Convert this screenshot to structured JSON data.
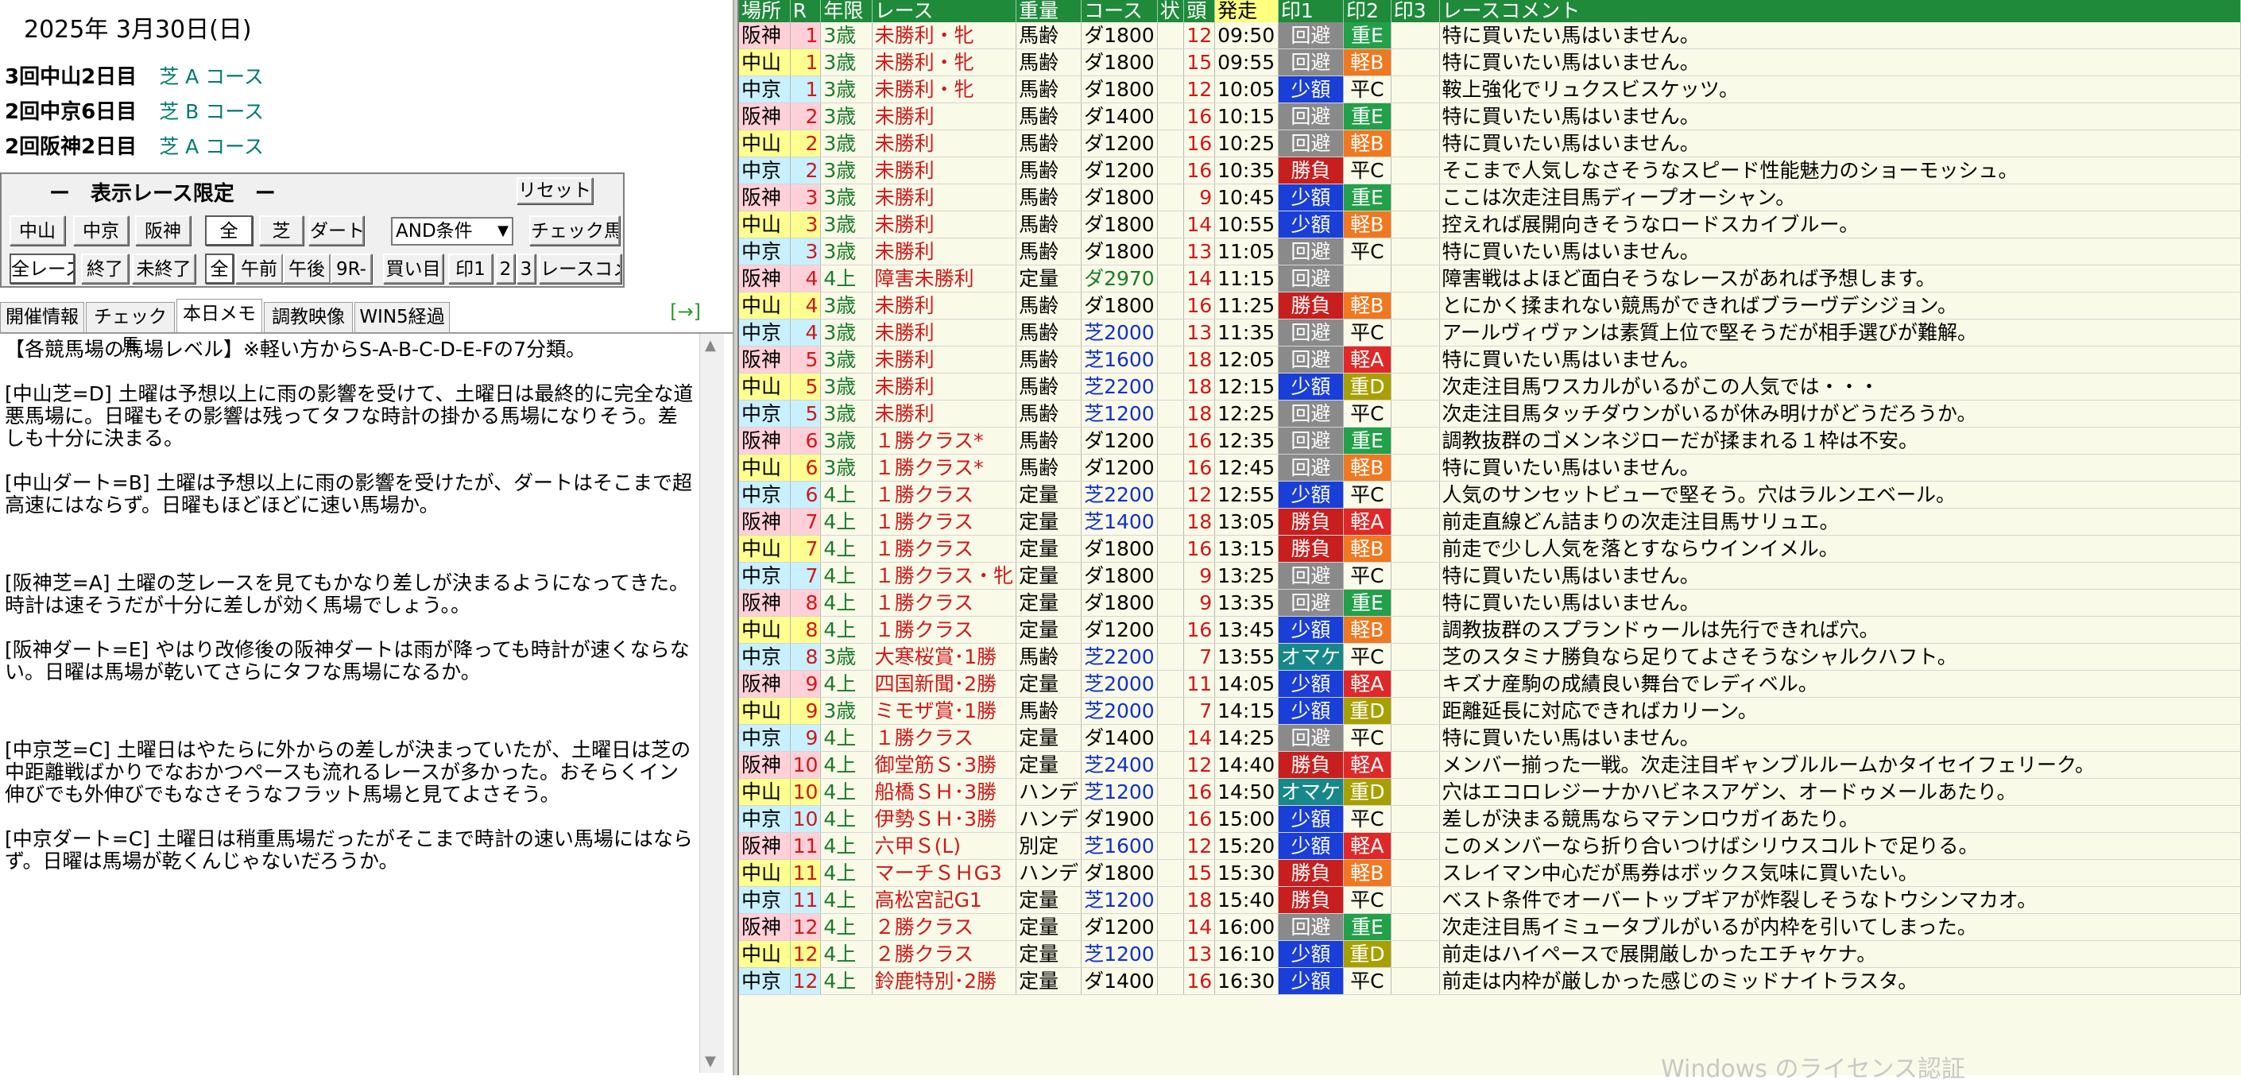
{
  "header": {
    "date": "2025年 3月30日(日)"
  },
  "meets": [
    {
      "name": "3回中山2日目",
      "course": "芝 A コース"
    },
    {
      "name": "2回中京6日目",
      "course": "芝 B コース"
    },
    {
      "name": "2回阪神2日目",
      "course": "芝 A コース"
    }
  ],
  "limit_panel": {
    "title": "ー　表示レース限定　ー",
    "reset": "リセット",
    "venues": [
      "中山",
      "中京",
      "阪神"
    ],
    "surface": [
      "全",
      "芝",
      "ダート"
    ],
    "condition_select": "AND条件",
    "check_horse": "チェック馬",
    "row3": [
      "全レース",
      "終了",
      "未終了",
      "全",
      "午前",
      "午後",
      "9R-",
      "買い目",
      "印1",
      "2",
      "3",
      "レースコメ"
    ]
  },
  "tabs": [
    "開催情報",
    "チェック馬",
    "本日メモ",
    "調教映像",
    "WIN5経過"
  ],
  "tab_arrow": "[→]",
  "memo": [
    "【各競馬場の馬場レベル】※軽い方からS-A-B-C-D-E-Fの7分類。",
    "[中山芝=D] 土曜は予想以上に雨の影響を受けて、土曜日は最終的に完全な道悪馬場に。日曜もその影響は残ってタフな時計の掛かる馬場になりそう。差しも十分に決まる。",
    "[中山ダート=B] 土曜は予想以上に雨の影響を受けたが、ダートはそこまで超高速にはならず。日曜もほどほどに速い馬場か。",
    "[阪神芝=A] 土曜の芝レースを見てもかなり差しが決まるようになってきた。時計は速そうだが十分に差しが効く馬場でしょう。。",
    "[阪神ダート=E] やはり改修後の阪神ダートは雨が降っても時計が速くならない。日曜は馬場が乾いてさらにタフな馬場になるか。",
    "[中京芝=C] 土曜日はやたらに外からの差しが決まっていたが、土曜日は芝の中距離戦ばかりでなおかつペースも流れるレースが多かった。おそらくイン伸びでも外伸びでもなさそうなフラット馬場と見てよさそう。",
    "[中京ダート=C] 土曜日は稍重馬場だったがそこまで時計の速い馬場にはならず。日曜は馬場が乾くんじゃないだろうか。"
  ],
  "table": {
    "headers": [
      "場所",
      "R",
      "年限",
      "レース",
      "重量",
      "コース",
      "状",
      "頭",
      "発走",
      "印1",
      "印2",
      "印3",
      "レースコメント"
    ],
    "rows": [
      [
        "阪神",
        "1",
        "3歳",
        "未勝利・牝",
        "馬齢",
        "ダ1800",
        "",
        "12",
        "09:50",
        "回避",
        "重E",
        "",
        "特に買いたい馬はいません。"
      ],
      [
        "中山",
        "1",
        "3歳",
        "未勝利・牝",
        "馬齢",
        "ダ1800",
        "",
        "15",
        "09:55",
        "回避",
        "軽B",
        "",
        "特に買いたい馬はいません。"
      ],
      [
        "中京",
        "1",
        "3歳",
        "未勝利・牝",
        "馬齢",
        "ダ1800",
        "",
        "12",
        "10:05",
        "少額",
        "平C",
        "",
        "鞍上強化でリュクスビスケッツ。"
      ],
      [
        "阪神",
        "2",
        "3歳",
        "未勝利",
        "馬齢",
        "ダ1400",
        "",
        "16",
        "10:15",
        "回避",
        "重E",
        "",
        "特に買いたい馬はいません。"
      ],
      [
        "中山",
        "2",
        "3歳",
        "未勝利",
        "馬齢",
        "ダ1200",
        "",
        "16",
        "10:25",
        "回避",
        "軽B",
        "",
        "特に買いたい馬はいません。"
      ],
      [
        "中京",
        "2",
        "3歳",
        "未勝利",
        "馬齢",
        "ダ1200",
        "",
        "16",
        "10:35",
        "勝負",
        "平C",
        "",
        "そこまで人気しなさそうなスピード性能魅力のショーモッシュ。"
      ],
      [
        "阪神",
        "3",
        "3歳",
        "未勝利",
        "馬齢",
        "ダ1800",
        "",
        "9",
        "10:45",
        "少額",
        "重E",
        "",
        "ここは次走注目馬ディープオーシャン。"
      ],
      [
        "中山",
        "3",
        "3歳",
        "未勝利",
        "馬齢",
        "ダ1800",
        "",
        "14",
        "10:55",
        "少額",
        "軽B",
        "",
        "控えれば展開向きそうなロードスカイブルー。"
      ],
      [
        "中京",
        "3",
        "3歳",
        "未勝利",
        "馬齢",
        "ダ1800",
        "",
        "13",
        "11:05",
        "回避",
        "平C",
        "",
        "特に買いたい馬はいません。"
      ],
      [
        "阪神",
        "4",
        "4上",
        "障害未勝利",
        "定量",
        "ダ2970",
        "",
        "14",
        "11:15",
        "回避",
        "",
        "",
        "障害戦はよほど面白そうなレースがあれば予想します。"
      ],
      [
        "中山",
        "4",
        "3歳",
        "未勝利",
        "馬齢",
        "ダ1800",
        "",
        "16",
        "11:25",
        "勝負",
        "軽B",
        "",
        "とにかく揉まれない競馬ができればブラーヴデシジョン。"
      ],
      [
        "中京",
        "4",
        "3歳",
        "未勝利",
        "馬齢",
        "芝2000",
        "",
        "13",
        "11:35",
        "回避",
        "平C",
        "",
        "アールヴィヴァンは素質上位で堅そうだが相手選びが難解。"
      ],
      [
        "阪神",
        "5",
        "3歳",
        "未勝利",
        "馬齢",
        "芝1600",
        "",
        "18",
        "12:05",
        "回避",
        "軽A",
        "",
        "特に買いたい馬はいません。"
      ],
      [
        "中山",
        "5",
        "3歳",
        "未勝利",
        "馬齢",
        "芝2200",
        "",
        "18",
        "12:15",
        "少額",
        "重D",
        "",
        "次走注目馬ワスカルがいるがこの人気では・・・"
      ],
      [
        "中京",
        "5",
        "3歳",
        "未勝利",
        "馬齢",
        "芝1200",
        "",
        "18",
        "12:25",
        "回避",
        "平C",
        "",
        "次走注目馬タッチダウンがいるが休み明けがどうだろうか。"
      ],
      [
        "阪神",
        "6",
        "3歳",
        "１勝クラス*",
        "馬齢",
        "ダ1200",
        "",
        "16",
        "12:35",
        "回避",
        "重E",
        "",
        "調教抜群のゴメンネジローだが揉まれる１枠は不安。"
      ],
      [
        "中山",
        "6",
        "3歳",
        "１勝クラス*",
        "馬齢",
        "ダ1200",
        "",
        "16",
        "12:45",
        "回避",
        "軽B",
        "",
        "特に買いたい馬はいません。"
      ],
      [
        "中京",
        "6",
        "4上",
        "１勝クラス",
        "定量",
        "芝2200",
        "",
        "12",
        "12:55",
        "少額",
        "平C",
        "",
        "人気のサンセットビューで堅そう。穴はラルンエベール。"
      ],
      [
        "阪神",
        "7",
        "4上",
        "１勝クラス",
        "定量",
        "芝1400",
        "",
        "18",
        "13:05",
        "勝負",
        "軽A",
        "",
        "前走直線どん詰まりの次走注目馬サリュエ。"
      ],
      [
        "中山",
        "7",
        "4上",
        "１勝クラス",
        "定量",
        "ダ1800",
        "",
        "16",
        "13:15",
        "勝負",
        "軽B",
        "",
        "前走で少し人気を落とすならウインイメル。"
      ],
      [
        "中京",
        "7",
        "4上",
        "１勝クラス・牝",
        "定量",
        "ダ1800",
        "",
        "9",
        "13:25",
        "回避",
        "平C",
        "",
        "特に買いたい馬はいません。"
      ],
      [
        "阪神",
        "8",
        "4上",
        "１勝クラス",
        "定量",
        "ダ1800",
        "",
        "9",
        "13:35",
        "回避",
        "重E",
        "",
        "特に買いたい馬はいません。"
      ],
      [
        "中山",
        "8",
        "4上",
        "１勝クラス",
        "定量",
        "ダ1200",
        "",
        "16",
        "13:45",
        "少額",
        "軽B",
        "",
        "調教抜群のスプランドゥールは先行できれば穴。"
      ],
      [
        "中京",
        "8",
        "3歳",
        "大寒桜賞･1勝",
        "馬齢",
        "芝2200",
        "",
        "7",
        "13:55",
        "オマケ",
        "平C",
        "",
        "芝のスタミナ勝負なら足りてよさそうなシャルクハフト。"
      ],
      [
        "阪神",
        "9",
        "4上",
        "四国新聞･2勝",
        "定量",
        "芝2000",
        "",
        "11",
        "14:05",
        "少額",
        "軽A",
        "",
        "キズナ産駒の成績良い舞台でレディベル。"
      ],
      [
        "中山",
        "9",
        "3歳",
        "ミモザ賞･1勝",
        "馬齢",
        "芝2000",
        "",
        "7",
        "14:15",
        "少額",
        "重D",
        "",
        "距離延長に対応できればカリーン。"
      ],
      [
        "中京",
        "9",
        "4上",
        "１勝クラス",
        "定量",
        "ダ1400",
        "",
        "14",
        "14:25",
        "回避",
        "平C",
        "",
        "特に買いたい馬はいません。"
      ],
      [
        "阪神",
        "10",
        "4上",
        "御堂筋Ｓ･3勝",
        "定量",
        "芝2400",
        "",
        "12",
        "14:40",
        "勝負",
        "軽A",
        "",
        "メンバー揃った一戦。次走注目ギャンブルルームかタイセイフェリーク。"
      ],
      [
        "中山",
        "10",
        "4上",
        "船橋ＳＨ･3勝",
        "ハンデ",
        "芝1200",
        "",
        "16",
        "14:50",
        "オマケ",
        "重D",
        "",
        "穴はエコロレジーナかハビネスアゲン、オードゥメールあたり。"
      ],
      [
        "中京",
        "10",
        "4上",
        "伊勢ＳＨ･3勝",
        "ハンデ",
        "ダ1900",
        "",
        "16",
        "15:00",
        "少額",
        "平C",
        "",
        "差しが決まる競馬ならマテンロウガイあたり。"
      ],
      [
        "阪神",
        "11",
        "4上",
        "六甲Ｓ(L)",
        "別定",
        "芝1600",
        "",
        "12",
        "15:20",
        "少額",
        "軽A",
        "",
        "このメンバーなら折り合いつけばシリウスコルトで足りる。"
      ],
      [
        "中山",
        "11",
        "4上",
        "マーチＳＨG3",
        "ハンデ",
        "ダ1800",
        "",
        "15",
        "15:30",
        "勝負",
        "軽B",
        "",
        "スレイマン中心だが馬券はボックス気味に買いたい。"
      ],
      [
        "中京",
        "11",
        "4上",
        "高松宮記G1",
        "定量",
        "芝1200",
        "",
        "18",
        "15:40",
        "勝負",
        "平C",
        "",
        "ベスト条件でオーバートップギアが炸裂しそうなトウシンマカオ。"
      ],
      [
        "阪神",
        "12",
        "4上",
        "２勝クラス",
        "定量",
        "ダ1200",
        "",
        "14",
        "16:00",
        "回避",
        "重E",
        "",
        "次走注目馬イミュータブルがいるが内枠を引いてしまった。"
      ],
      [
        "中山",
        "12",
        "4上",
        "２勝クラス",
        "定量",
        "芝1200",
        "",
        "13",
        "16:10",
        "少額",
        "重D",
        "",
        "前走はハイペースで展開厳しかったエチャケナ。"
      ],
      [
        "中京",
        "12",
        "4上",
        "鈴鹿特別･2勝",
        "定量",
        "ダ1400",
        "",
        "16",
        "16:30",
        "少額",
        "平C",
        "",
        "前走は内枠が厳しかった感じのミッドナイトラスタ。"
      ]
    ]
  },
  "watermark": "Windows のライセンス認証",
  "colors": {
    "header_green": "#1e8a3a",
    "venue_hanshin": "#ffd0d8",
    "venue_nakayama": "#ffff90",
    "venue_chukyo": "#c8f0ff",
    "mark_kaihi": "#8a8a8a",
    "mark_shogaku": "#1a3ed8",
    "mark_shobu": "#c81e1e",
    "mark_omake": "#17888a",
    "ba_heavy_e": "#22a04a",
    "ba_light_b": "#f07820",
    "ba_light_a": "#e02828",
    "ba_heavy_d": "#a8a000"
  }
}
